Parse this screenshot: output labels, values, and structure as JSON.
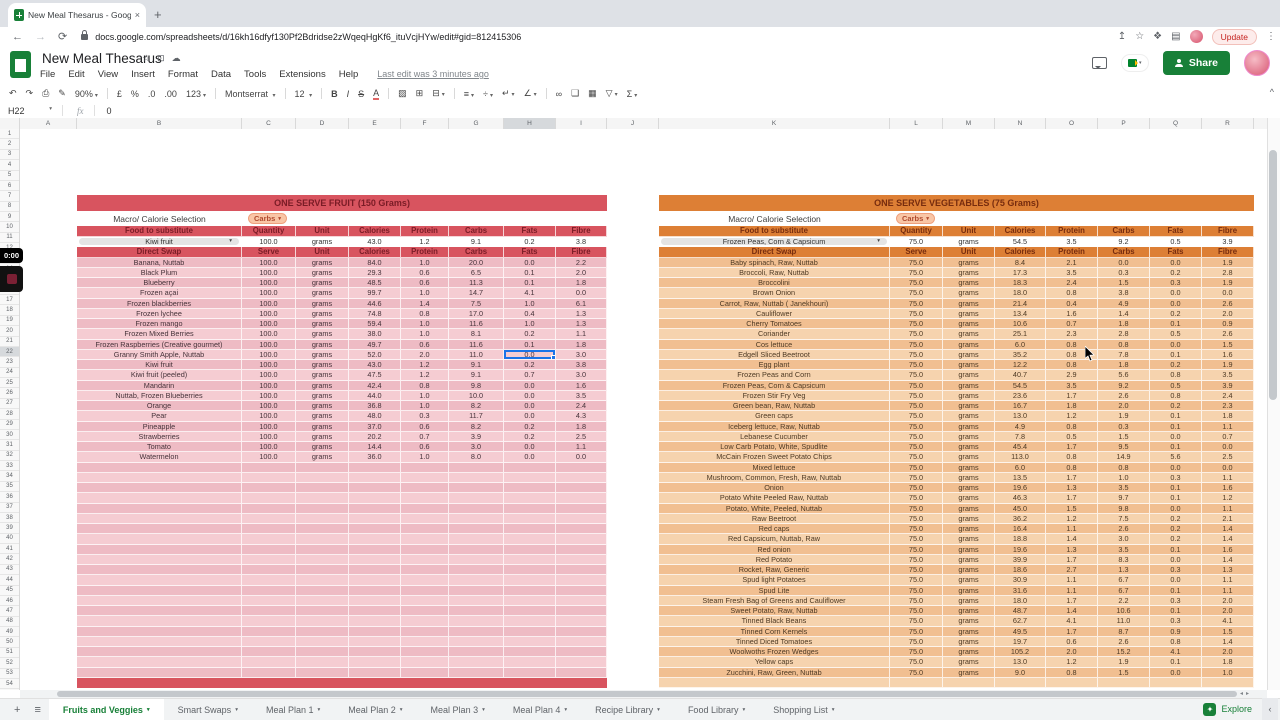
{
  "browser": {
    "tab_title": "New Meal Thesarus - Google S",
    "close_glyph": "×",
    "url": "docs.google.com/spreadsheets/d/16kh16dfyf130Pf2Bdridse2zWqeqHgKf6_ituVcjHYw/edit#gid=812415306",
    "update_label": "Update"
  },
  "app": {
    "title": "New Meal Thesarus",
    "menu": [
      "File",
      "Edit",
      "View",
      "Insert",
      "Format",
      "Data",
      "Tools",
      "Extensions",
      "Help"
    ],
    "last_edit": "Last edit was 3 minutes ago",
    "share_label": "Share"
  },
  "toolbar": {
    "zoom": "90%",
    "currency": "£",
    "percent": "%",
    "dec_less": ".0",
    "dec_more": ".00",
    "number_format": "123",
    "font": "Montserrat",
    "font_size": "12"
  },
  "formula_bar": {
    "name_box": "H22",
    "fx_label": "fx",
    "value": "0"
  },
  "grid": {
    "columns": [
      "A",
      "B",
      "C",
      "D",
      "E",
      "F",
      "G",
      "H",
      "I",
      "J",
      "K",
      "L",
      "M",
      "N",
      "O",
      "P",
      "Q",
      "R"
    ],
    "selected_column": "H",
    "selected_row": 22,
    "row_count": 54
  },
  "overlay": {
    "timer": "0:00"
  },
  "selection": {
    "cell_ref": "H22",
    "table": "fruit",
    "row_label": "Granny Smith Apple, Nuttab",
    "column": "Fats",
    "value": "0.0"
  },
  "fruit_table": {
    "title": "ONE SERVE FRUIT (150 Grams)",
    "macro_label": "Macro/ Calorie Selection",
    "macro_value": "Carbs",
    "substitute_header": [
      "Food to substitute",
      "Quantity",
      "Unit",
      "Calories",
      "Protein",
      "Carbs",
      "Fats",
      "Fibre"
    ],
    "substitute": {
      "food": "Kiwi fruit",
      "values": [
        "100.0",
        "grams",
        "43.0",
        "1.2",
        "9.1",
        "0.2",
        "3.8"
      ]
    },
    "swap_header": [
      "Direct Swap",
      "Serve",
      "Unit",
      "Calories",
      "Protein",
      "Carbs",
      "Fats",
      "Fibre"
    ],
    "rows": [
      [
        "Banana, Nuttab",
        "100.0",
        "grams",
        "84.0",
        "1.0",
        "20.0",
        "0.0",
        "2.2"
      ],
      [
        "Black Plum",
        "100.0",
        "grams",
        "29.3",
        "0.6",
        "6.5",
        "0.1",
        "2.0"
      ],
      [
        "Blueberry",
        "100.0",
        "grams",
        "48.5",
        "0.6",
        "11.3",
        "0.1",
        "1.8"
      ],
      [
        "Frozen açai",
        "100.0",
        "grams",
        "99.7",
        "1.0",
        "14.7",
        "4.1",
        "0.0"
      ],
      [
        "Frozen blackberries",
        "100.0",
        "grams",
        "44.6",
        "1.4",
        "7.5",
        "1.0",
        "6.1"
      ],
      [
        "Frozen lychee",
        "100.0",
        "grams",
        "74.8",
        "0.8",
        "17.0",
        "0.4",
        "1.3"
      ],
      [
        "Frozen mango",
        "100.0",
        "grams",
        "59.4",
        "1.0",
        "11.6",
        "1.0",
        "1.3"
      ],
      [
        "Frozen Mixed Berries",
        "100.0",
        "grams",
        "38.0",
        "1.0",
        "8.1",
        "0.2",
        "1.1"
      ],
      [
        "Frozen Raspberries (Creative gourmet)",
        "100.0",
        "grams",
        "49.7",
        "0.6",
        "11.6",
        "0.1",
        "1.8"
      ],
      [
        "Granny Smith Apple, Nuttab",
        "100.0",
        "grams",
        "52.0",
        "2.0",
        "11.0",
        "0.0",
        "3.0"
      ],
      [
        "Kiwi fruit",
        "100.0",
        "grams",
        "43.0",
        "1.2",
        "9.1",
        "0.2",
        "3.8"
      ],
      [
        "Kiwi fruit (peeled)",
        "100.0",
        "grams",
        "47.5",
        "1.2",
        "9.1",
        "0.7",
        "3.0"
      ],
      [
        "Mandarin",
        "100.0",
        "grams",
        "42.4",
        "0.8",
        "9.8",
        "0.0",
        "1.6"
      ],
      [
        "Nuttab, Frozen Blueberries",
        "100.0",
        "grams",
        "44.0",
        "1.0",
        "10.0",
        "0.0",
        "3.5"
      ],
      [
        "Orange",
        "100.0",
        "grams",
        "36.8",
        "1.0",
        "8.2",
        "0.0",
        "2.4"
      ],
      [
        "Pear",
        "100.0",
        "grams",
        "48.0",
        "0.3",
        "11.7",
        "0.0",
        "4.3"
      ],
      [
        "Pineapple",
        "100.0",
        "grams",
        "37.0",
        "0.6",
        "8.2",
        "0.2",
        "1.8"
      ],
      [
        "Strawberries",
        "100.0",
        "grams",
        "20.2",
        "0.7",
        "3.9",
        "0.2",
        "2.5"
      ],
      [
        "Tomato",
        "100.0",
        "grams",
        "14.4",
        "0.6",
        "3.0",
        "0.0",
        "1.1"
      ],
      [
        "Watermelon",
        "100.0",
        "grams",
        "36.0",
        "1.0",
        "8.0",
        "0.0",
        "0.0"
      ]
    ],
    "empty_row_count": 21
  },
  "veg_table": {
    "title": "ONE SERVE VEGETABLES  (75 Grams)",
    "macro_label": "Macro/ Calorie Selection",
    "macro_value": "Carbs",
    "substitute_header": [
      "Food to substitute",
      "Quantity",
      "Unit",
      "Calories",
      "Protein",
      "Carbs",
      "Fats",
      "Fibre"
    ],
    "substitute": {
      "food": "Frozen Peas, Corn & Capsicum",
      "values": [
        "75.0",
        "grams",
        "54.5",
        "3.5",
        "9.2",
        "0.5",
        "3.9"
      ]
    },
    "swap_header": [
      "Direct Swap",
      "Serve",
      "Unit",
      "Calories",
      "Protein",
      "Carbs",
      "Fats",
      "Fibre"
    ],
    "rows": [
      [
        "Baby spinach, Raw, Nuttab",
        "75.0",
        "grams",
        "8.4",
        "2.1",
        "0.0",
        "0.0",
        "1.9"
      ],
      [
        "Broccoli, Raw, Nuttab",
        "75.0",
        "grams",
        "17.3",
        "3.5",
        "0.3",
        "0.2",
        "2.8"
      ],
      [
        "Broccolini",
        "75.0",
        "grams",
        "18.3",
        "2.4",
        "1.5",
        "0.3",
        "1.9"
      ],
      [
        "Brown Onion",
        "75.0",
        "grams",
        "18.0",
        "0.8",
        "3.8",
        "0.0",
        "0.0"
      ],
      [
        "Carrot, Raw, Nuttab ( Janekhouri)",
        "75.0",
        "grams",
        "21.4",
        "0.4",
        "4.9",
        "0.0",
        "2.6"
      ],
      [
        "Cauliflower",
        "75.0",
        "grams",
        "13.4",
        "1.6",
        "1.4",
        "0.2",
        "2.0"
      ],
      [
        "Cherry Tomatoes",
        "75.0",
        "grams",
        "10.6",
        "0.7",
        "1.8",
        "0.1",
        "0.9"
      ],
      [
        "Coriander",
        "75.0",
        "grams",
        "25.1",
        "2.3",
        "2.8",
        "0.5",
        "2.6"
      ],
      [
        "Cos lettuce",
        "75.0",
        "grams",
        "6.0",
        "0.8",
        "0.8",
        "0.0",
        "1.5"
      ],
      [
        "Edgell Sliced Beetroot",
        "75.0",
        "grams",
        "35.2",
        "0.8",
        "7.8",
        "0.1",
        "1.6"
      ],
      [
        "Egg plant",
        "75.0",
        "grams",
        "12.2",
        "0.8",
        "1.8",
        "0.2",
        "1.9"
      ],
      [
        "Frozen Peas and Corn",
        "75.0",
        "grams",
        "40.7",
        "2.9",
        "5.6",
        "0.8",
        "3.5"
      ],
      [
        "Frozen Peas, Corn & Capsicum",
        "75.0",
        "grams",
        "54.5",
        "3.5",
        "9.2",
        "0.5",
        "3.9"
      ],
      [
        "Frozen Stir Fry Veg",
        "75.0",
        "grams",
        "23.6",
        "1.7",
        "2.6",
        "0.8",
        "2.4"
      ],
      [
        "Green bean, Raw, Nuttab",
        "75.0",
        "grams",
        "16.7",
        "1.8",
        "2.0",
        "0.2",
        "2.3"
      ],
      [
        "Green caps",
        "75.0",
        "grams",
        "13.0",
        "1.2",
        "1.9",
        "0.1",
        "1.8"
      ],
      [
        "Iceberg lettuce, Raw, Nuttab",
        "75.0",
        "grams",
        "4.9",
        "0.8",
        "0.3",
        "0.1",
        "1.1"
      ],
      [
        "Lebanese Cucumber",
        "75.0",
        "grams",
        "7.8",
        "0.5",
        "1.5",
        "0.0",
        "0.7"
      ],
      [
        "Low Carb Potato, White, Spudlite",
        "75.0",
        "grams",
        "45.4",
        "1.7",
        "9.5",
        "0.1",
        "0.0"
      ],
      [
        "McCain Frozen Sweet Potato Chips",
        "75.0",
        "grams",
        "113.0",
        "0.8",
        "14.9",
        "5.6",
        "2.5"
      ],
      [
        "Mixed lettuce",
        "75.0",
        "grams",
        "6.0",
        "0.8",
        "0.8",
        "0.0",
        "0.0"
      ],
      [
        "Mushroom, Common, Fresh, Raw, Nuttab",
        "75.0",
        "grams",
        "13.5",
        "1.7",
        "1.0",
        "0.3",
        "1.1"
      ],
      [
        "Onion",
        "75.0",
        "grams",
        "19.6",
        "1.3",
        "3.5",
        "0.1",
        "1.6"
      ],
      [
        "Potato White Peeled Raw, Nuttab",
        "75.0",
        "grams",
        "46.3",
        "1.7",
        "9.7",
        "0.1",
        "1.2"
      ],
      [
        "Potato, White, Peeled, Nuttab",
        "75.0",
        "grams",
        "45.0",
        "1.5",
        "9.8",
        "0.0",
        "1.1"
      ],
      [
        "Raw Beetroot",
        "75.0",
        "grams",
        "36.2",
        "1.2",
        "7.5",
        "0.2",
        "2.1"
      ],
      [
        "Red caps",
        "75.0",
        "grams",
        "16.4",
        "1.1",
        "2.6",
        "0.2",
        "1.4"
      ],
      [
        "Red Capsicum, Nuttab, Raw",
        "75.0",
        "grams",
        "18.8",
        "1.4",
        "3.0",
        "0.2",
        "1.4"
      ],
      [
        "Red onion",
        "75.0",
        "grams",
        "19.6",
        "1.3",
        "3.5",
        "0.1",
        "1.6"
      ],
      [
        "Red Potato",
        "75.0",
        "grams",
        "39.9",
        "1.7",
        "8.3",
        "0.0",
        "1.4"
      ],
      [
        "Rocket, Raw, Generic",
        "75.0",
        "grams",
        "18.6",
        "2.7",
        "1.3",
        "0.3",
        "1.3"
      ],
      [
        "Spud light Potatoes",
        "75.0",
        "grams",
        "30.9",
        "1.1",
        "6.7",
        "0.0",
        "1.1"
      ],
      [
        "Spud Lite",
        "75.0",
        "grams",
        "31.6",
        "1.1",
        "6.7",
        "0.1",
        "1.1"
      ],
      [
        "Steam Fresh Bag of Greens and Cauliflower",
        "75.0",
        "grams",
        "18.0",
        "1.7",
        "2.2",
        "0.3",
        "2.0"
      ],
      [
        "Sweet Potato, Raw, Nuttab",
        "75.0",
        "grams",
        "48.7",
        "1.4",
        "10.6",
        "0.1",
        "2.0"
      ],
      [
        "Tinned Black Beans",
        "75.0",
        "grams",
        "62.7",
        "4.1",
        "11.0",
        "0.3",
        "4.1"
      ],
      [
        "Tinned Corn Kernels",
        "75.0",
        "grams",
        "49.5",
        "1.7",
        "8.7",
        "0.9",
        "1.5"
      ],
      [
        "Tinned Diced Tomatoes",
        "75.0",
        "grams",
        "19.7",
        "0.6",
        "2.6",
        "0.8",
        "1.4"
      ],
      [
        "Woolwoths Frozen Wedges",
        "75.0",
        "grams",
        "105.2",
        "2.0",
        "15.2",
        "4.1",
        "2.0"
      ],
      [
        "Yellow caps",
        "75.0",
        "grams",
        "13.0",
        "1.2",
        "1.9",
        "0.1",
        "1.8"
      ],
      [
        "Zucchini, Raw, Green, Nuttab",
        "75.0",
        "grams",
        "9.0",
        "0.8",
        "1.5",
        "0.0",
        "1.0"
      ]
    ],
    "empty_row_count": 1
  },
  "sheet_tabs": [
    "Fruits and Veggies",
    "Smart Swaps",
    "Meal Plan 1",
    "Meal Plan 2",
    "Meal Plan 3",
    "Meal Plan 4",
    "Recipe Library",
    "Food Library",
    "Shopping List"
  ],
  "active_sheet_tab": "Fruits and Veggies",
  "explore_label": "Explore",
  "colors": {
    "fruit_header": "#d8545f",
    "fruit_row_light": "#f5ccd2",
    "fruit_row_dark": "#eebbc4",
    "veg_header": "#dd7f35",
    "veg_row_light": "#f6d3ae",
    "veg_row_dark": "#f1bf91",
    "selection_blue": "#1a73e8",
    "share_green": "#188038",
    "chip_bg": "#f9c6a6"
  }
}
